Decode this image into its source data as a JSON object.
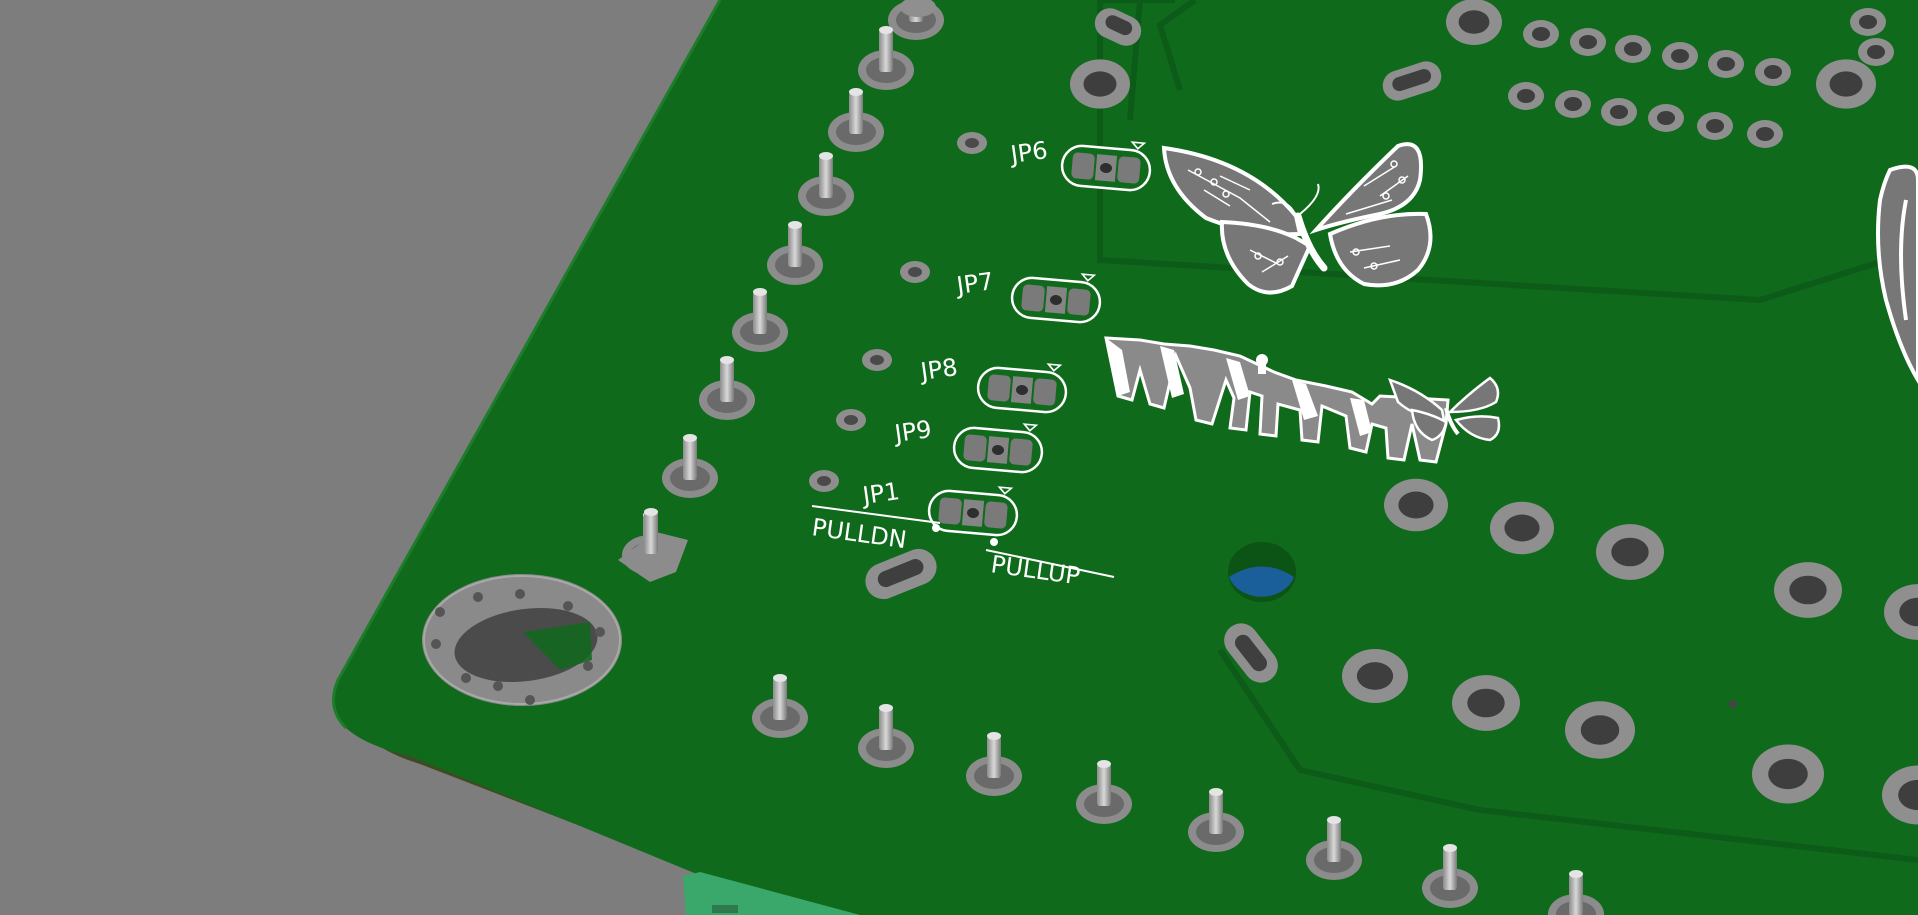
{
  "board": {
    "colors": {
      "background": "#7d7d7d",
      "solder_mask": "#0f6a1c",
      "solder_mask_dark": "#0b5415",
      "board_edge": "#3d4a22",
      "silkscreen": "#ffffff",
      "pad_ring": "#9a9a9a",
      "hole": "#5a5a5a",
      "blue_marker": "#1a5f9a",
      "connector": "#3aa86a"
    },
    "silkscreen_labels": {
      "jp6": "JP6",
      "jp7": "JP7",
      "jp8": "JP8",
      "jp9": "JP9",
      "jp1": "JP1",
      "pulldn": "PULLDN",
      "pullup": "PULLUP"
    },
    "logos": {
      "large_butterfly": "butterfly-logo",
      "wyolum_logo": "WyoLum",
      "small_butterfly": "butterfly-logo"
    },
    "icons": {
      "jumper_pad": "solder-jumper-icon",
      "header_pin": "header-pin-icon",
      "mounting_hole": "mounting-hole-icon"
    }
  }
}
